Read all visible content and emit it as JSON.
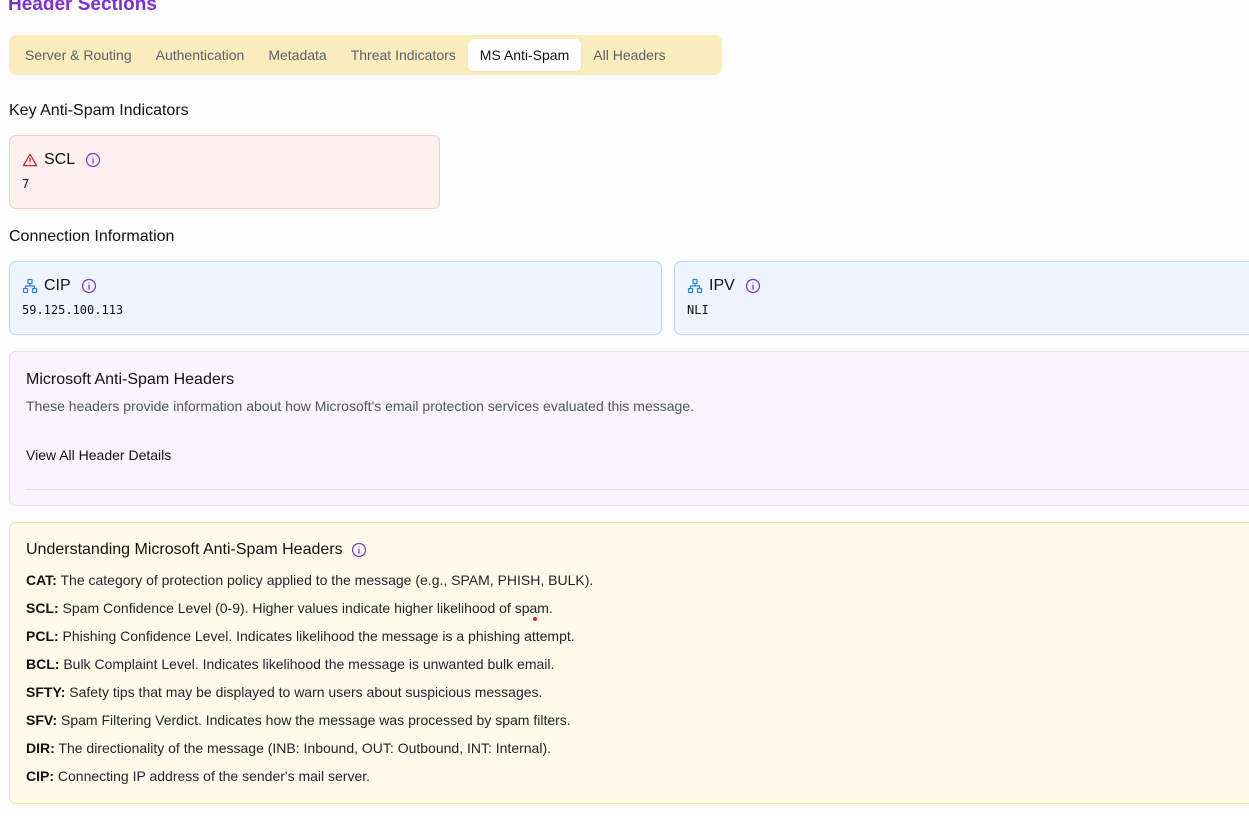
{
  "header": {
    "title": "Header Sections"
  },
  "tabs": [
    {
      "label": "Server & Routing",
      "active": false
    },
    {
      "label": "Authentication",
      "active": false
    },
    {
      "label": "Metadata",
      "active": false
    },
    {
      "label": "Threat Indicators",
      "active": false
    },
    {
      "label": "MS Anti-Spam",
      "active": true
    },
    {
      "label": "All Headers",
      "active": false
    }
  ],
  "key_indicators": {
    "title": "Key Anti-Spam Indicators",
    "scl": {
      "label": "SCL",
      "value": "7",
      "icon": "warning-triangle-icon"
    }
  },
  "connection": {
    "title": "Connection Information",
    "cip": {
      "label": "CIP",
      "value": "59.125.100.113",
      "icon": "network-icon"
    },
    "ipv": {
      "label": "IPV",
      "value": "NLI",
      "icon": "network-icon"
    }
  },
  "ms_headers": {
    "title": "Microsoft Anti-Spam Headers",
    "description": "These headers provide information about how Microsoft's email protection services evaluated this message.",
    "view_all": "View All Header Details"
  },
  "understanding": {
    "title": "Understanding Microsoft Anti-Spam Headers",
    "items": [
      {
        "key": "CAT:",
        "text": " The category of protection policy applied to the message (e.g., SPAM, PHISH, BULK)."
      },
      {
        "key": "SCL:",
        "text": " Spam Confidence Level (0-9). Higher values indicate higher likelihood of spam."
      },
      {
        "key": "PCL:",
        "text": " Phishing Confidence Level. Indicates likelihood the message is a phishing attempt."
      },
      {
        "key": "BCL:",
        "text": " Bulk Complaint Level. Indicates likelihood the message is unwanted bulk email."
      },
      {
        "key": "SFTY:",
        "text": " Safety tips that may be displayed to warn users about suspicious messages."
      },
      {
        "key": "SFV:",
        "text": " Spam Filtering Verdict. Indicates how the message was processed by spam filters."
      },
      {
        "key": "DIR:",
        "text": " The directionality of the message (INB: Inbound, OUT: Outbound, INT: Internal)."
      },
      {
        "key": "CIP:",
        "text": " Connecting IP address of the sender's mail server."
      }
    ]
  },
  "colors": {
    "accent_purple": "#7e2fd6",
    "tab_bar": "#fbecbd",
    "danger": "#dc2626",
    "info_blue": "#2f7fd8"
  }
}
